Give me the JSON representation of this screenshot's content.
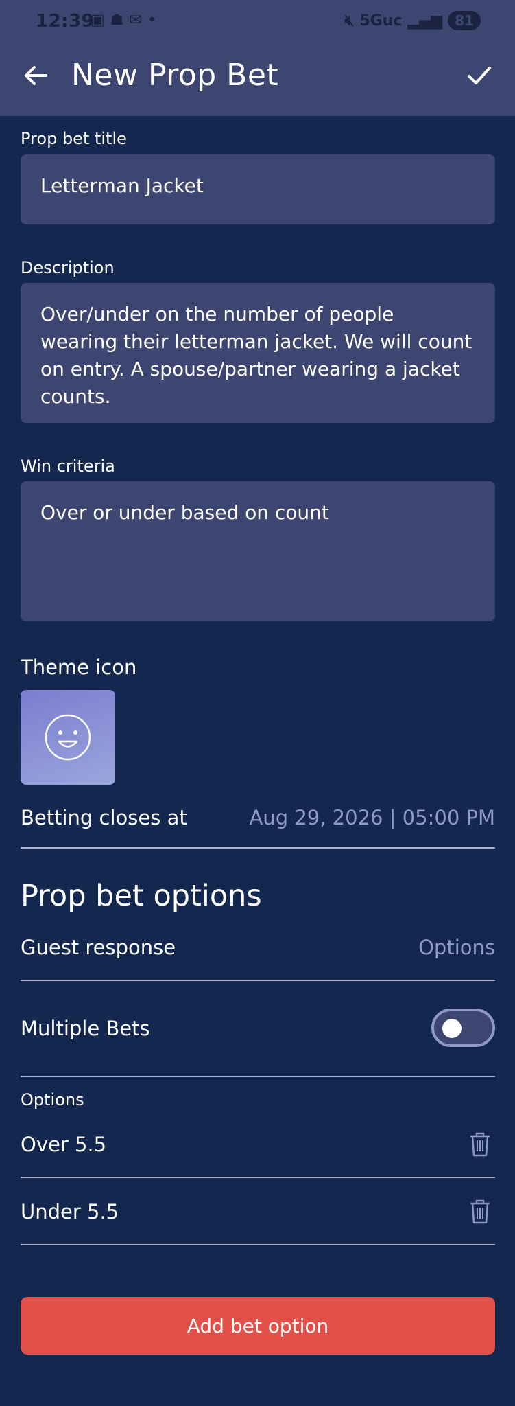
{
  "status_bar": {
    "time": "12:39",
    "network": "5Guc",
    "battery": "81"
  },
  "app_bar": {
    "title": "New Prop Bet",
    "back_icon": "arrow-left-icon",
    "confirm_icon": "check-icon"
  },
  "form": {
    "title_label": "Prop bet title",
    "title_value": "Letterman Jacket",
    "description_label": "Description",
    "description_value": "Over/under on the number of people wearing their letterman jacket. We will count on entry. A spouse/partner wearing a jacket counts.",
    "win_criteria_label": "Win criteria",
    "win_criteria_value": "Over or under based on count",
    "theme_icon_label": "Theme icon",
    "theme_icon": "smiley-face-icon",
    "betting_closes_label": "Betting closes at",
    "betting_closes_value": "Aug 29, 2026 | 05:00 PM"
  },
  "prop_bet_options": {
    "section_title": "Prop bet options",
    "guest_response_label": "Guest response",
    "guest_response_value": "Options",
    "multiple_bets_label": "Multiple Bets",
    "multiple_bets_on": false,
    "options_label": "Options",
    "options": [
      {
        "label": "Over 5.5"
      },
      {
        "label": "Under 5.5"
      }
    ],
    "add_button_label": "Add bet option"
  },
  "colors": {
    "background": "#14274f",
    "surface": "#3d4670",
    "accent_button": "#e2504a",
    "muted_text": "#8f99c2"
  }
}
